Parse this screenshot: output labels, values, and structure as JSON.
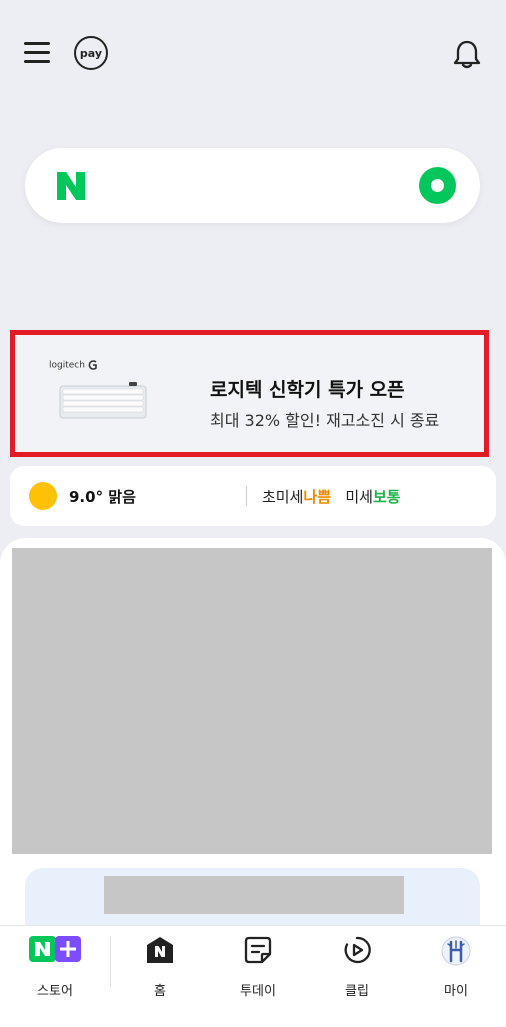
{
  "topbar": {
    "menu_icon": "hamburger-menu-icon",
    "pay_label": "pay",
    "bell_icon": "bell-icon"
  },
  "search": {
    "logo": "N",
    "green_button_icon": "green-lens-icon"
  },
  "ad": {
    "brand": "logitech",
    "title": "로지텍 신학기 특가 오픈",
    "subtitle": "최대 32% 할인! 재고소진 시 종료"
  },
  "weather": {
    "temperature": "9.0° 맑음",
    "fine_dust_label": "초미세",
    "fine_dust_value": "나쁨",
    "dust_label": "미세",
    "dust_value": "보통"
  },
  "nav": {
    "items": [
      {
        "label": "스토어",
        "icon": "store-icon"
      },
      {
        "label": "홈",
        "icon": "home-icon"
      },
      {
        "label": "투데이",
        "icon": "today-icon"
      },
      {
        "label": "클립",
        "icon": "clip-icon"
      },
      {
        "label": "마이",
        "icon": "profile-avatar-icon"
      }
    ]
  },
  "colors": {
    "brand_green": "#03c75a",
    "ad_border": "#e21b24",
    "bad": "#f08a00",
    "ok": "#1fb34d",
    "store_purple": "#7b4dff"
  }
}
